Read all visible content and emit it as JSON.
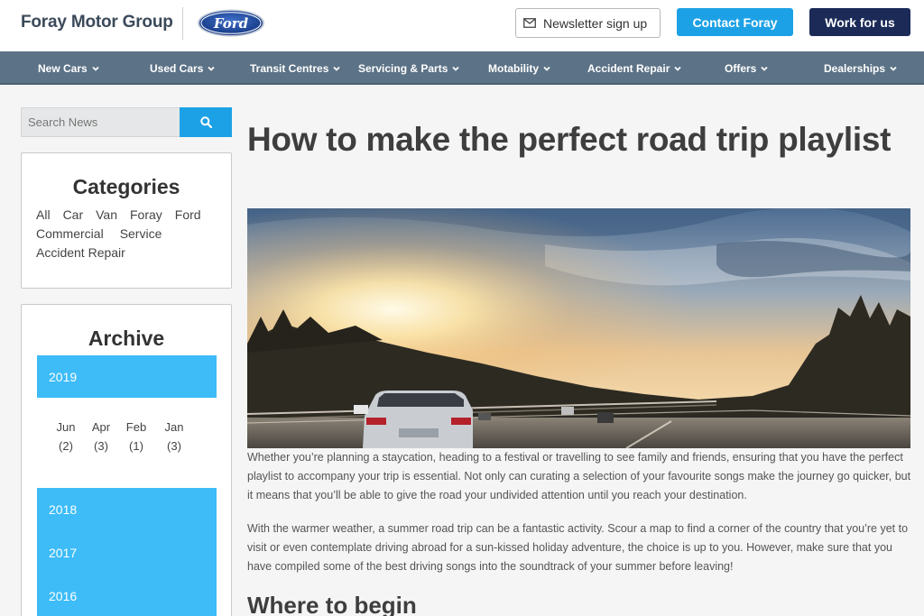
{
  "header": {
    "brand": "Foray Motor Group",
    "ford_logo": "Ford",
    "newsletter_label": "Newsletter sign up",
    "contact_label": "Contact Foray",
    "work_label": "Work for us"
  },
  "nav": {
    "items": [
      "New Cars",
      "Used Cars",
      "Transit Centres",
      "Servicing & Parts",
      "Motability",
      "Accident Repair",
      "Offers",
      "Dealerships"
    ]
  },
  "sidebar": {
    "search_placeholder": "Search News",
    "categories": {
      "title": "Categories",
      "links": [
        "All",
        "Car",
        "Van",
        "Foray",
        "Ford",
        "Commercial",
        "Service",
        "Accident Repair"
      ]
    },
    "archive": {
      "title": "Archive",
      "years": [
        "2019",
        "2018",
        "2017",
        "2016"
      ],
      "months": [
        {
          "name": "Jun",
          "count": "(2)"
        },
        {
          "name": "Apr",
          "count": "(3)"
        },
        {
          "name": "Feb",
          "count": "(1)"
        },
        {
          "name": "Jan",
          "count": "(3)"
        }
      ]
    }
  },
  "article": {
    "title": "How to make the perfect road trip playlist",
    "paragraph1": "Whether you’re planning a staycation, heading to a festival or travelling to see family and friends, ensuring that you have the perfect playlist to accompany your trip is essential. Not only can curating a selection of your favourite songs make the journey go quicker, but it means that you’ll be able to give the road your undivided attention until you reach your destination.",
    "paragraph2": "With the warmer weather, a summer road trip can be a fantastic activity. Scour a map to find a corner of the country that you’re yet to visit or even contemplate driving abroad for a sun-kissed holiday adventure, the choice is up to you. However, make sure that you have compiled some of the best driving songs into the soundtrack of your summer before leaving!",
    "subheading": "Where to begin"
  },
  "colors": {
    "accent_blue": "#1da1e6",
    "navy": "#1b2a57",
    "nav_bg": "#5c7286",
    "archive_blue": "#3dbcf8"
  },
  "icons": {
    "newsletter": "mail-icon",
    "search": "search-icon",
    "nav_dropdown": "chevron-down-icon"
  }
}
